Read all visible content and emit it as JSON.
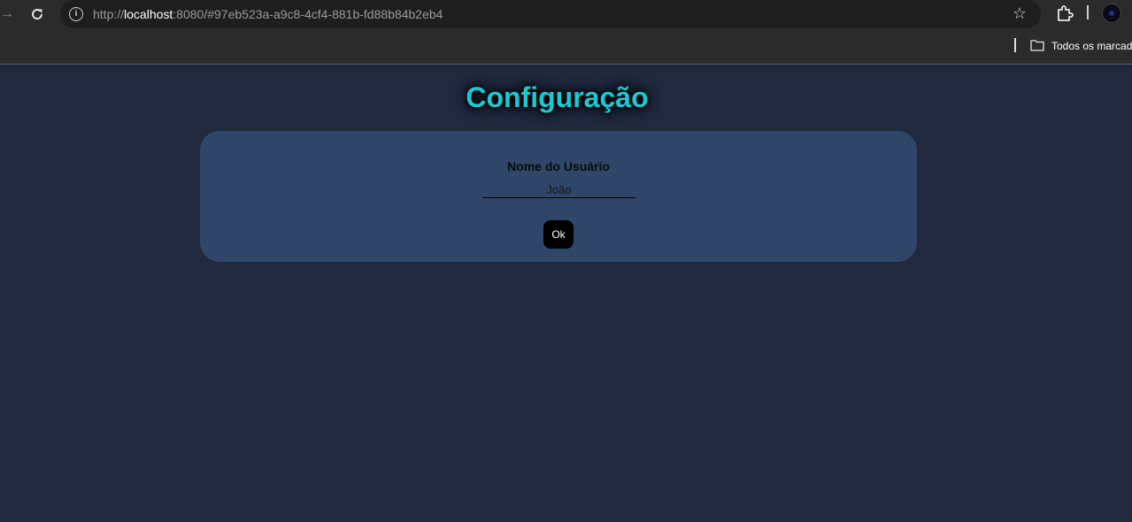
{
  "browser": {
    "url_scheme": "http://",
    "url_host": "localhost",
    "url_rest": ":8080/#97eb523a-a9c8-4cf4-881b-fd88b84b2eb4",
    "bookmarks_folder_label": "Todos os marcado",
    "icons": [
      "forward-icon",
      "reload-icon",
      "info-icon",
      "star-icon",
      "extensions-icon",
      "folder-icon"
    ]
  },
  "page": {
    "title": "Configuração",
    "title_color": "#1ec8d0",
    "background_color": "#21293f",
    "card_color": "#2f4668"
  },
  "form": {
    "username_label": "Nome do Usuário",
    "username_value": "João",
    "ok_label": "Ok"
  }
}
